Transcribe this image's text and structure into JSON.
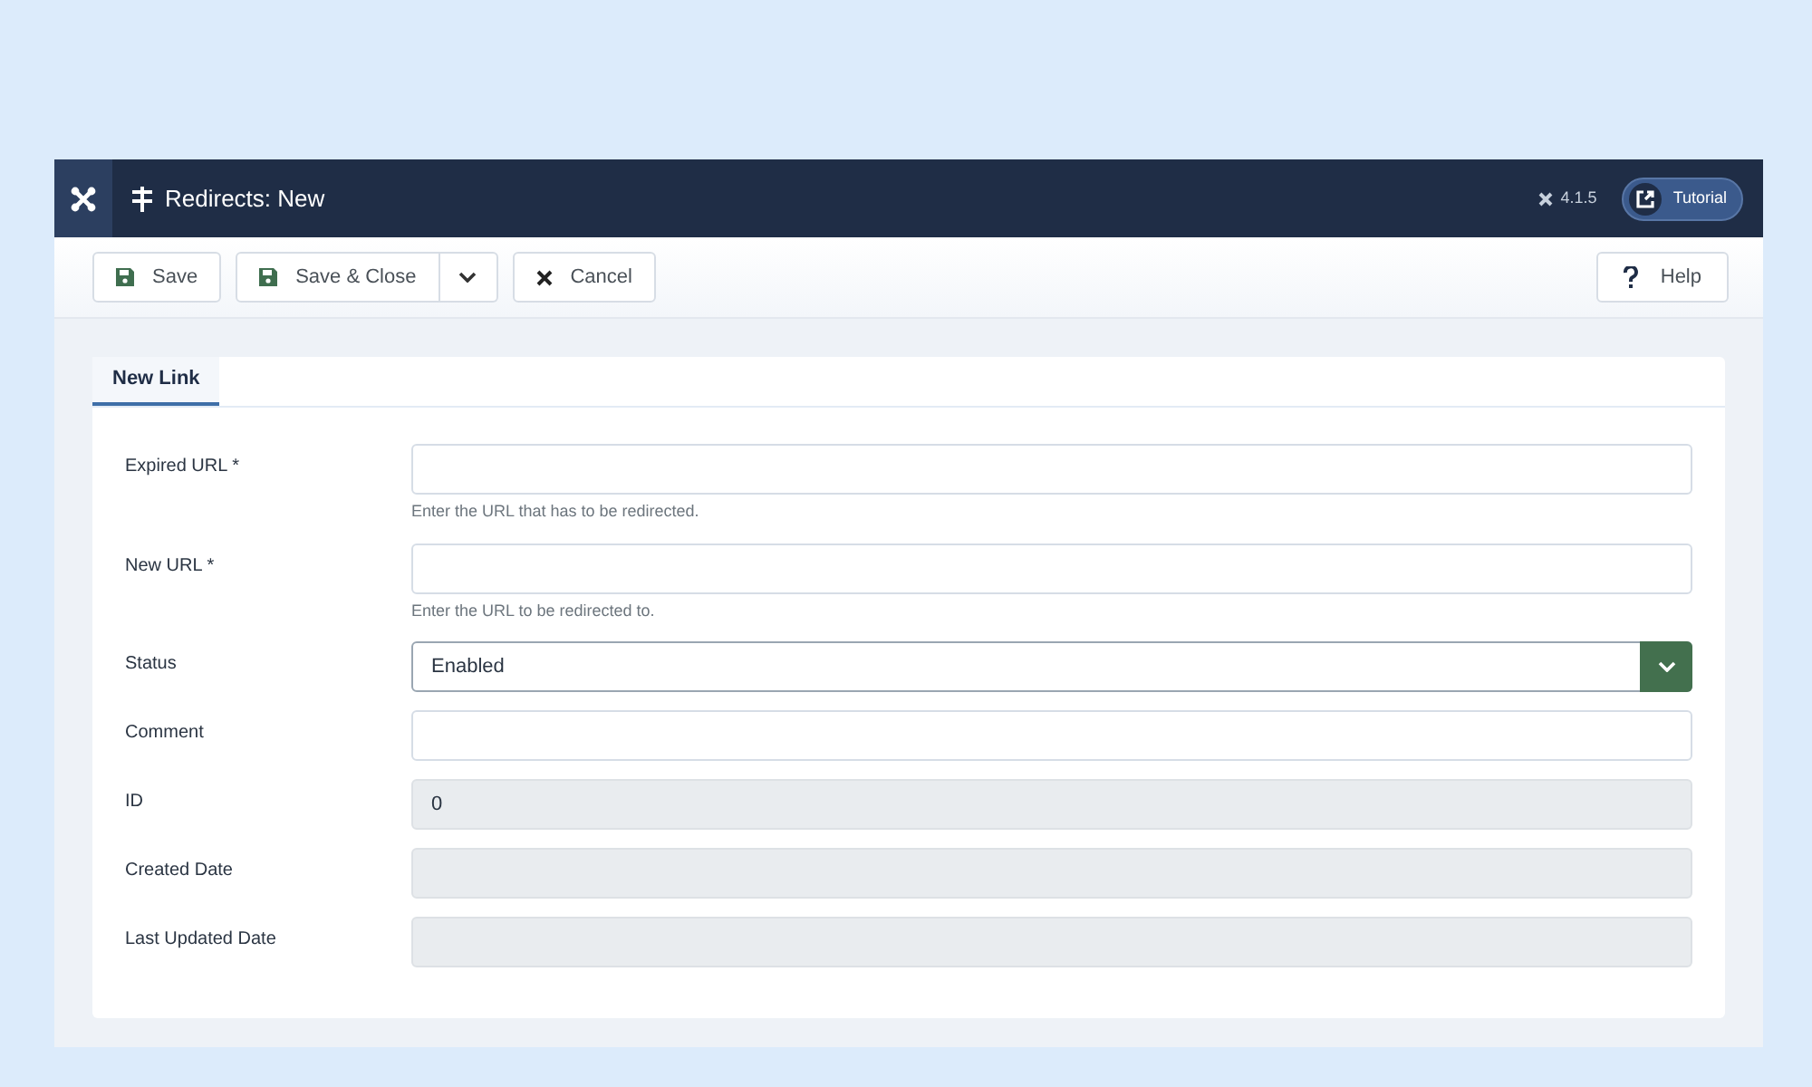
{
  "header": {
    "title": "Redirects: New",
    "version": "4.1.5",
    "tutorial": "Tutorial"
  },
  "toolbar": {
    "buttons": [
      {
        "label": "Save",
        "kind": "save"
      },
      {
        "label": "Save & Close",
        "kind": "save-split"
      },
      {
        "label": "Cancel",
        "kind": "cancel"
      }
    ],
    "help": "Help"
  },
  "tabs": [
    {
      "label": "New Link",
      "selected": true
    }
  ],
  "fields": [
    {
      "kind": "text",
      "label": "Expired URL *",
      "hint": "Enter the URL that has to be redirected."
    },
    {
      "kind": "text",
      "label": "New URL *",
      "hint": "Enter the URL to be redirected to."
    },
    {
      "kind": "select",
      "label": "Status",
      "value": "Enabled"
    },
    {
      "kind": "text",
      "label": "Comment"
    },
    {
      "kind": "readonly",
      "label": "ID",
      "value": "0"
    },
    {
      "kind": "readonly",
      "label": "Created Date"
    },
    {
      "kind": "readonly",
      "label": "Last Updated Date"
    }
  ]
}
